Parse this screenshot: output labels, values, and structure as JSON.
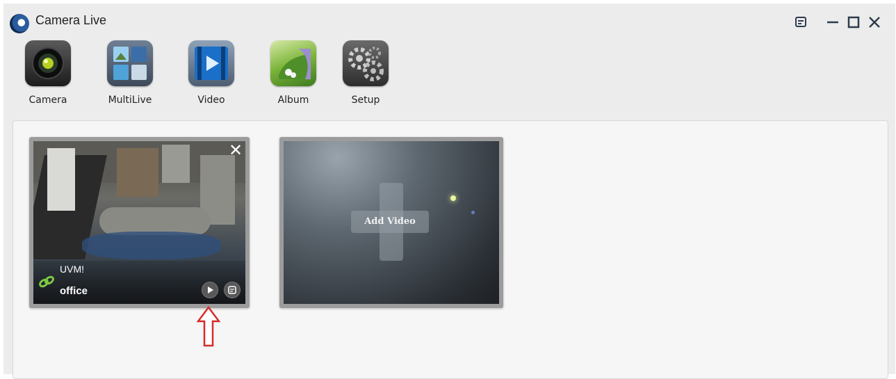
{
  "app": {
    "title": "Camera Live"
  },
  "toolbar": {
    "items": [
      {
        "label": "Camera",
        "icon": "camera-icon"
      },
      {
        "label": "MultiLive",
        "icon": "multilive-icon"
      },
      {
        "label": "Video",
        "icon": "video-icon"
      },
      {
        "label": "Album",
        "icon": "album-icon"
      },
      {
        "label": "Setup",
        "icon": "gear-icon"
      }
    ]
  },
  "window_controls": [
    "feedback-icon",
    "minimize-icon",
    "maximize-icon",
    "close-icon"
  ],
  "camera_tile": {
    "uid_text": "UVM!",
    "name": "office",
    "close_glyph": "✕",
    "link_color": "#7ac943"
  },
  "add_tile": {
    "label": "Add Video"
  },
  "annotation": {
    "arrow_color": "#d62b2b"
  }
}
